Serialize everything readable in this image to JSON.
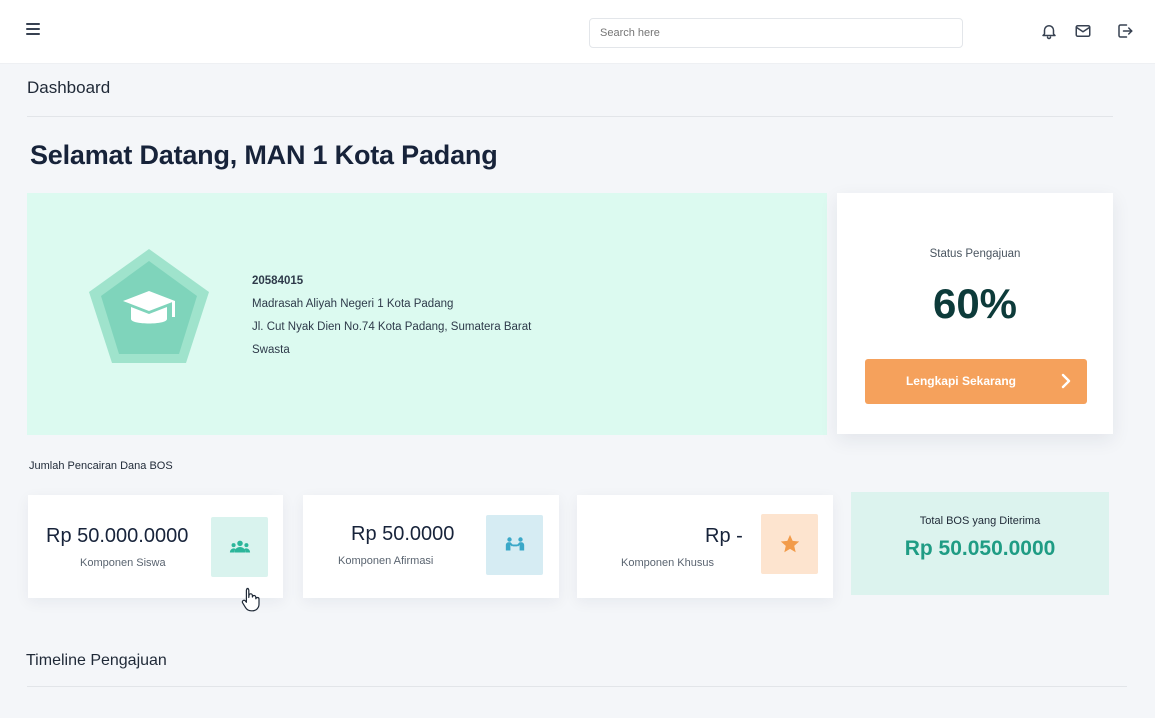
{
  "header": {
    "search_placeholder": "Search here",
    "icons": [
      "menu-icon",
      "bell-icon",
      "mail-icon",
      "logout-icon"
    ]
  },
  "page": {
    "title": "Dashboard",
    "welcome": "Selamat Datang, MAN 1 Kota Padang"
  },
  "school": {
    "npsn": "20584015",
    "name": "Madrasah Aliyah Negeri 1 Kota Padang",
    "address": "Jl. Cut Nyak Dien No.74 Kota Padang, Sumatera Barat",
    "status": "Swasta",
    "logo_icon": "graduation-cap-icon"
  },
  "submission": {
    "label": "Status Pengajuan",
    "value": "60%",
    "progress_percent": 60,
    "cta_label": "Lengkapi Sekarang"
  },
  "bos": {
    "section_label": "Jumlah Pencairan Dana BOS",
    "cards": [
      {
        "amount": "Rp 50.000.0000",
        "label": "Komponen Siswa",
        "icon": "students-icon",
        "badge_color": "#d9f3ee"
      },
      {
        "amount": "Rp 50.0000",
        "label": "Komponen Afirmasi",
        "icon": "handshake-icon",
        "badge_color": "#d6ecf3"
      },
      {
        "amount": "Rp -",
        "label": "Komponen Khusus",
        "icon": "star-icon",
        "badge_color": "#fde4cf"
      }
    ],
    "total_label": "Total BOS yang Diterima",
    "total_value": "Rp 50.050.0000"
  },
  "timeline": {
    "title": "Timeline Pengajuan"
  },
  "colors": {
    "accent_orange": "#f5a15c",
    "accent_teal": "#1f9c84",
    "banner_bg": "#dcfaf0",
    "dark_text": "#17233a"
  }
}
